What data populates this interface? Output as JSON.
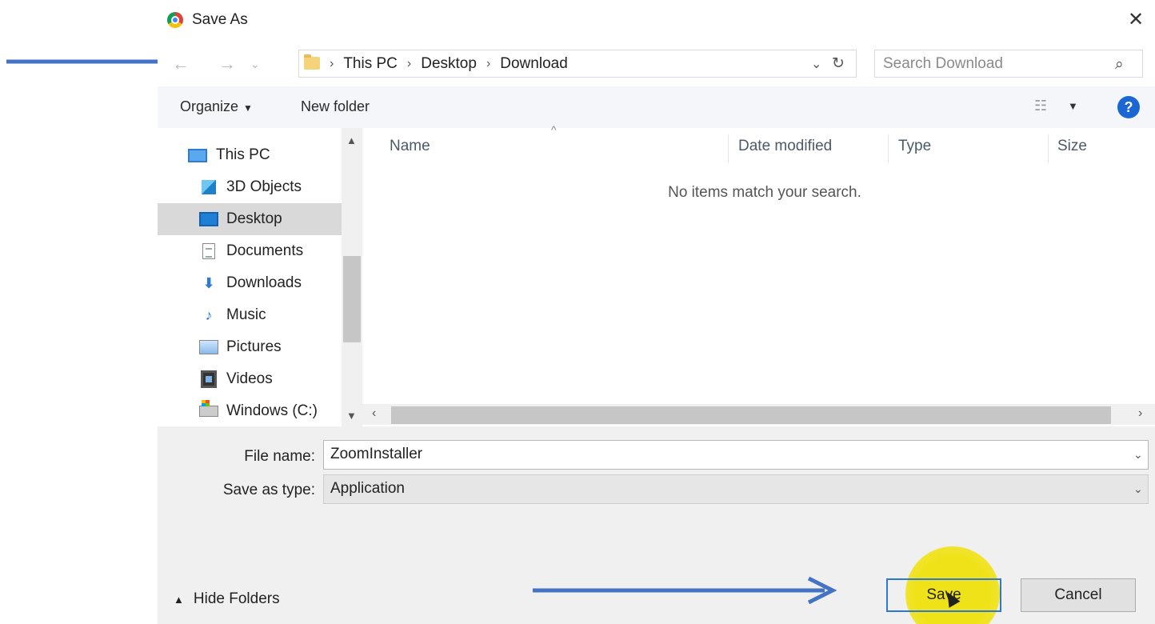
{
  "window": {
    "title": "Save As",
    "close_glyph": "✕"
  },
  "address_bar": {
    "breadcrumbs": [
      "This PC",
      "Desktop",
      "Download"
    ],
    "separator": "›",
    "dropdown_glyph": "⌄",
    "refresh_glyph": "↻"
  },
  "search": {
    "placeholder": "Search Download",
    "icon": "search-icon"
  },
  "toolbar": {
    "organize_label": "Organize",
    "organize_caret": "▼",
    "new_folder_label": "New folder",
    "help_label": "?"
  },
  "nav_pane": {
    "items": [
      {
        "label": "This PC",
        "icon": "this-pc-icon",
        "selected": false
      },
      {
        "label": "3D Objects",
        "icon": "3d-objects-icon",
        "selected": false
      },
      {
        "label": "Desktop",
        "icon": "desktop-icon",
        "selected": true
      },
      {
        "label": "Documents",
        "icon": "documents-icon",
        "selected": false
      },
      {
        "label": "Downloads",
        "icon": "downloads-icon",
        "selected": false
      },
      {
        "label": "Music",
        "icon": "music-icon",
        "selected": false
      },
      {
        "label": "Pictures",
        "icon": "pictures-icon",
        "selected": false
      },
      {
        "label": "Videos",
        "icon": "videos-icon",
        "selected": false
      },
      {
        "label": "Windows (C:)",
        "icon": "drive-icon",
        "selected": false
      }
    ]
  },
  "file_list": {
    "columns": [
      "Name",
      "Date modified",
      "Type",
      "Size"
    ],
    "empty_message": "No items match your search."
  },
  "form": {
    "file_name_label": "File name:",
    "file_name_value": "ZoomInstaller",
    "save_as_type_label": "Save as type:",
    "save_as_type_value": "Application"
  },
  "footer": {
    "hide_folders_label": "Hide Folders",
    "save_label": "Save",
    "cancel_label": "Cancel"
  },
  "colors": {
    "accent": "#2c78d4",
    "annotation_arrow": "#4472c4",
    "highlight": "#f0e214",
    "selected_row": "#d9d9d9"
  }
}
